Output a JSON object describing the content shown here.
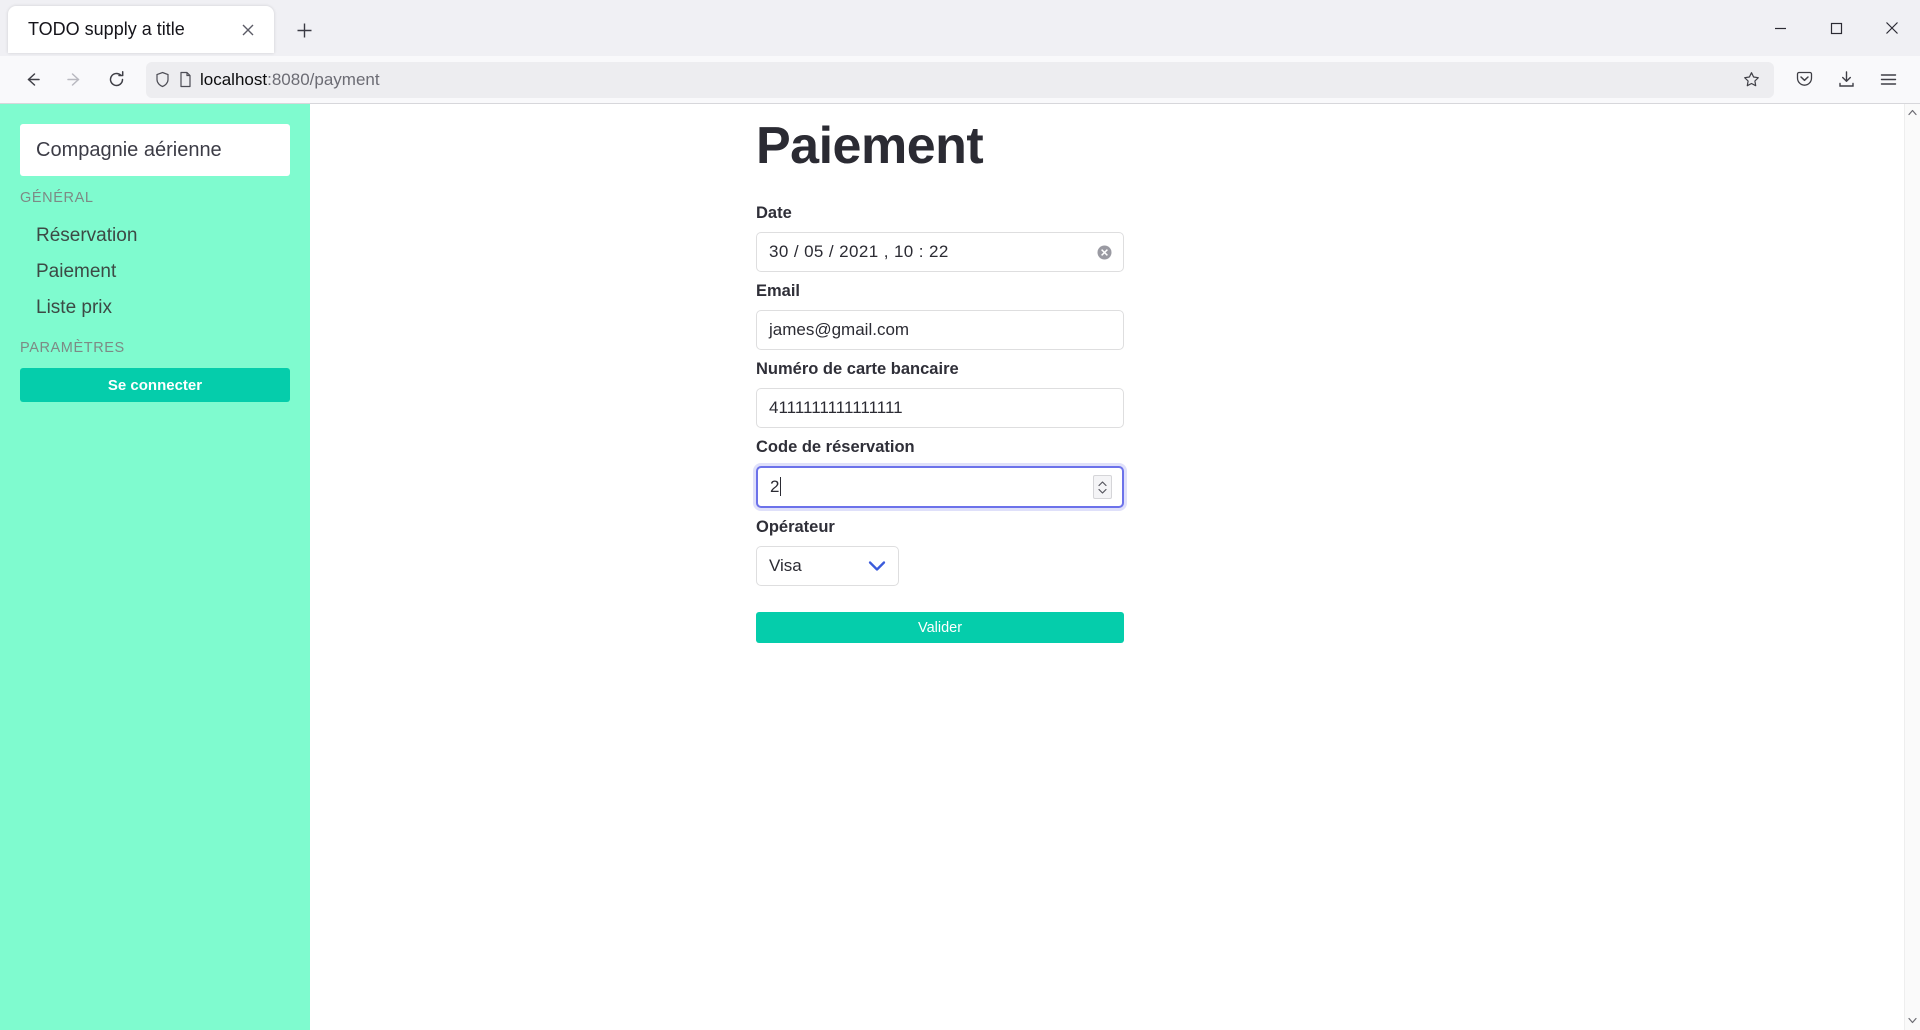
{
  "browser": {
    "tab": {
      "title": "TODO supply a title",
      "close_icon": "close-icon"
    },
    "new_tab_icon": "plus-icon",
    "window_controls": {
      "minimize": "minimize-icon",
      "maximize": "maximize-icon",
      "close": "window-close-icon"
    },
    "nav": {
      "back": "back-arrow-icon",
      "forward": "forward-arrow-icon",
      "reload": "reload-icon"
    },
    "url": {
      "host": "localhost",
      "path": ":8080/payment",
      "shield_icon": "shield-icon",
      "page_icon": "page-icon",
      "bookmark_icon": "star-icon"
    },
    "toolbar": {
      "pocket": "pocket-icon",
      "downloads": "download-icon",
      "menu": "hamburger-menu-icon"
    }
  },
  "sidebar": {
    "brand": "Compagnie aérienne",
    "sections": [
      {
        "label": "GÉNÉRAL",
        "items": [
          {
            "label": "Réservation"
          },
          {
            "label": "Paiement"
          },
          {
            "label": "Liste prix"
          }
        ]
      },
      {
        "label": "PARAMÈTRES",
        "items": []
      }
    ],
    "login_button": "Se connecter",
    "bg_color": "#7FFBCF",
    "accent_color": "#05CDAB"
  },
  "main": {
    "title": "Paiement",
    "fields": [
      {
        "label": "Date",
        "value": "30 / 05 / 2021 ,  10 : 22",
        "type": "datetime",
        "clear_icon": "clear-circle-icon"
      },
      {
        "label": "Email",
        "value": "james@gmail.com",
        "type": "email"
      },
      {
        "label": "Numéro de carte bancaire",
        "value": "4111111111111111",
        "type": "text"
      },
      {
        "label": "Code de réservation",
        "value": "2",
        "type": "number",
        "focused": true,
        "spinner_icon": "spinner-arrows-icon"
      },
      {
        "label": "Opérateur",
        "value": "Visa",
        "type": "select",
        "chevron_icon": "chevron-down-icon"
      }
    ],
    "submit_button": "Valider",
    "submit_color": "#05CDAB"
  },
  "scrollbar": {
    "up_icon": "scroll-up-icon",
    "down_icon": "scroll-down-icon"
  }
}
